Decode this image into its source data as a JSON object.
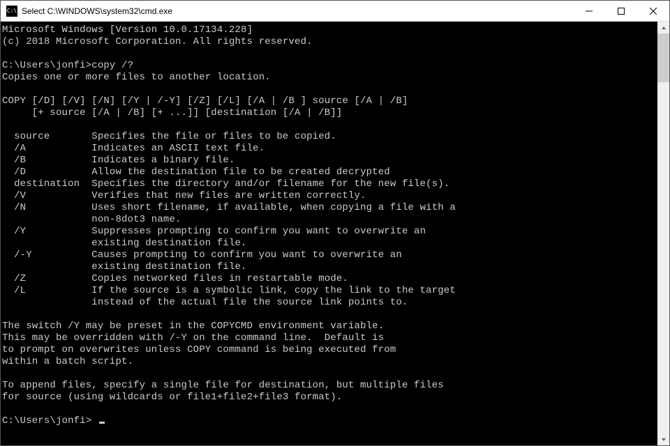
{
  "window": {
    "title": "Select C:\\WINDOWS\\system32\\cmd.exe"
  },
  "term": {
    "l01": "Microsoft Windows [Version 10.0.17134.228]",
    "l02": "(c) 2018 Microsoft Corporation. All rights reserved.",
    "l03": "",
    "l04": "C:\\Users\\jonfi>copy /?",
    "l05": "Copies one or more files to another location.",
    "l06": "",
    "l07": "COPY [/D] [/V] [/N] [/Y | /-Y] [/Z] [/L] [/A | /B ] source [/A | /B]",
    "l08": "     [+ source [/A | /B] [+ ...]] [destination [/A | /B]]",
    "l09": "",
    "l10": "  source       Specifies the file or files to be copied.",
    "l11": "  /A           Indicates an ASCII text file.",
    "l12": "  /B           Indicates a binary file.",
    "l13": "  /D           Allow the destination file to be created decrypted",
    "l14": "  destination  Specifies the directory and/or filename for the new file(s).",
    "l15": "  /V           Verifies that new files are written correctly.",
    "l16": "  /N           Uses short filename, if available, when copying a file with a",
    "l17": "               non-8dot3 name.",
    "l18": "  /Y           Suppresses prompting to confirm you want to overwrite an",
    "l19": "               existing destination file.",
    "l20": "  /-Y          Causes prompting to confirm you want to overwrite an",
    "l21": "               existing destination file.",
    "l22": "  /Z           Copies networked files in restartable mode.",
    "l23": "  /L           If the source is a symbolic link, copy the link to the target",
    "l24": "               instead of the actual file the source link points to.",
    "l25": "",
    "l26": "The switch /Y may be preset in the COPYCMD environment variable.",
    "l27": "This may be overridden with /-Y on the command line.  Default is",
    "l28": "to prompt on overwrites unless COPY command is being executed from",
    "l29": "within a batch script.",
    "l30": "",
    "l31": "To append files, specify a single file for destination, but multiple files",
    "l32": "for source (using wildcards or file1+file2+file3 format).",
    "l33": "",
    "l34": "C:\\Users\\jonfi> "
  }
}
